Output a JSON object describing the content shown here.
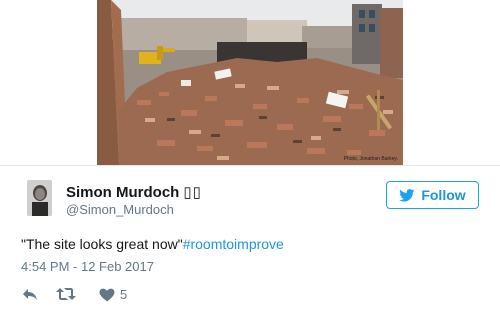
{
  "media": {
    "photo_credit": "Photo, Jonathan Barkey."
  },
  "user": {
    "display_name": "Simon Murdoch",
    "name_suffix": "▯▯",
    "handle": "@Simon_Murdoch"
  },
  "follow_button": {
    "label": "Follow"
  },
  "tweet": {
    "text": "\"The site looks great now\"",
    "hashtag": "#roomtoimprove",
    "timestamp": "4:54 PM - 12 Feb 2017"
  },
  "actions": {
    "like_count": "5"
  },
  "colors": {
    "accent": "#1da1f2",
    "link": "#1b95e0",
    "muted": "#657786",
    "text": "#14171a"
  },
  "icons": {
    "follow": "twitter-bird-icon",
    "reply": "reply-icon",
    "retweet": "retweet-icon",
    "like": "heart-icon"
  }
}
